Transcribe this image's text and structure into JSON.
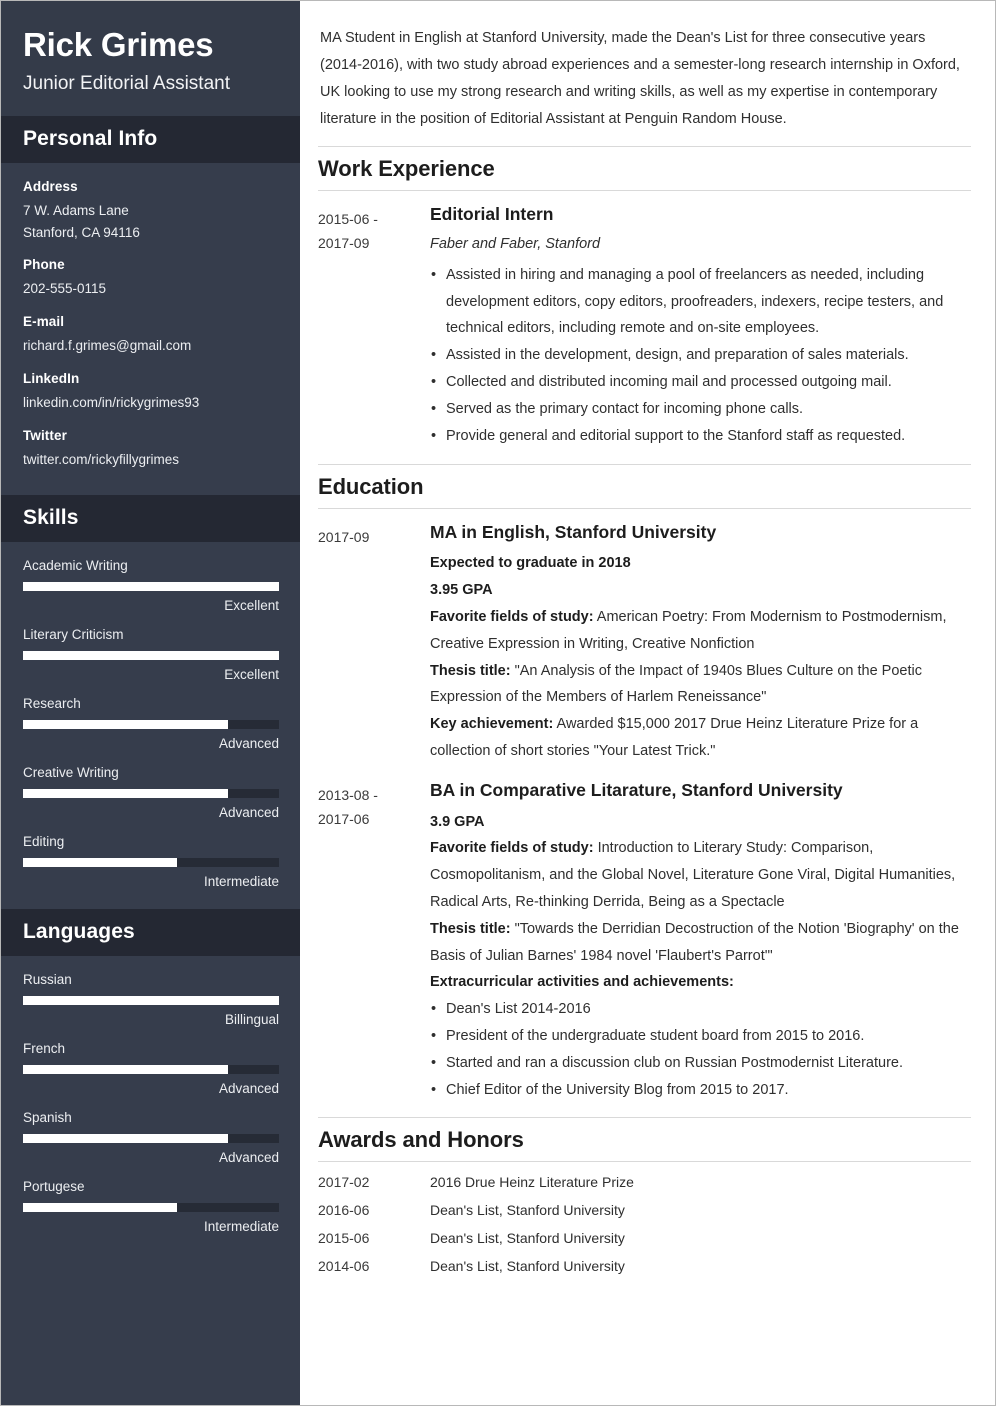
{
  "theme": {
    "sidebar_bg": "#363d4c",
    "sidebar_band_bg": "#242833",
    "sidebar_text": "#ffffff",
    "meter_fill": "#ffffff",
    "meter_track": "#262b36",
    "main_bg": "#ffffff",
    "main_text": "#2f2f2f",
    "rule": "#d9d9d9"
  },
  "sidebar": {
    "name": "Rick Grimes",
    "job_title": "Junior Editorial Assistant",
    "personal_info": {
      "heading": "Personal Info",
      "groups": [
        {
          "label": "Address",
          "lines": [
            "7 W. Adams Lane",
            "Stanford, CA 94116"
          ]
        },
        {
          "label": "Phone",
          "lines": [
            "202-555-0115"
          ]
        },
        {
          "label": "E-mail",
          "lines": [
            "richard.f.grimes@gmail.com"
          ]
        },
        {
          "label": "LinkedIn",
          "lines": [
            "linkedin.com/in/rickygrimes93"
          ]
        },
        {
          "label": "Twitter",
          "lines": [
            "twitter.com/rickyfillygrimes"
          ]
        }
      ]
    },
    "skills": {
      "heading": "Skills",
      "items": [
        {
          "name": "Academic Writing",
          "level": "Excellent",
          "percent": 100
        },
        {
          "name": "Literary Criticism",
          "level": "Excellent",
          "percent": 100
        },
        {
          "name": "Research",
          "level": "Advanced",
          "percent": 80
        },
        {
          "name": "Creative Writing",
          "level": "Advanced",
          "percent": 80
        },
        {
          "name": "Editing",
          "level": "Intermediate",
          "percent": 60
        }
      ]
    },
    "languages": {
      "heading": "Languages",
      "items": [
        {
          "name": "Russian",
          "level": "Billingual",
          "percent": 100
        },
        {
          "name": "French",
          "level": "Advanced",
          "percent": 80
        },
        {
          "name": "Spanish",
          "level": "Advanced",
          "percent": 80
        },
        {
          "name": "Portugese",
          "level": "Intermediate",
          "percent": 60
        }
      ]
    }
  },
  "main": {
    "summary": "MA Student in English at Stanford University, made the Dean's List for three consecutive years (2014-2016), with two study abroad experiences and a semester-long research internship in Oxford, UK looking to use my strong research and writing skills, as well as my expertise in contemporary literature in the position of Editorial Assistant at Penguin Random House.",
    "work_experience": {
      "heading": "Work Experience",
      "entries": [
        {
          "date_start": "2015-06 -",
          "date_end": "2017-09",
          "title": "Editorial Intern",
          "employer": "Faber and Faber, Stanford",
          "bullets": [
            "Assisted in hiring and managing a pool of freelancers as needed, including development editors, copy editors, proofreaders, indexers, recipe testers, and technical editors, including remote and on-site employees.",
            "Assisted in the development, design, and preparation of sales materials.",
            "Collected and distributed incoming mail and processed outgoing mail.",
            "Served as the primary contact for incoming phone calls.",
            "Provide general and editorial support to the Stanford staff as requested."
          ]
        }
      ]
    },
    "education": {
      "heading": "Education",
      "entries": [
        {
          "date_start": "2017-09",
          "date_end": "",
          "title": "MA in English, Stanford University",
          "strong_lines": [
            "Expected to graduate in 2018",
            "3.95 GPA"
          ],
          "details": [
            {
              "label": "Favorite fields of study:",
              "text": " American Poetry: From Modernism to Postmodernism, Creative Expression in Writing, Creative Nonfiction"
            },
            {
              "label": "Thesis title:",
              "text": " \"An Analysis of the Impact of 1940s Blues Culture on the Poetic Expression of the Members of Harlem Reneissance\""
            },
            {
              "label": "Key achievement:",
              "text": " Awarded $15,000 2017 Drue Heinz Literature Prize for a collection of short stories \"Your Latest Trick.\""
            }
          ],
          "bullets_heading": "",
          "bullets": []
        },
        {
          "date_start": "2013-08 -",
          "date_end": "2017-06",
          "title": "BA in Comparative Litarature, Stanford University",
          "strong_lines": [
            "3.9 GPA"
          ],
          "details": [
            {
              "label": "Favorite fields of study:",
              "text": " Introduction to Literary Study: Comparison, Cosmopolitanism, and the Global Novel, Literature Gone Viral, Digital Humanities, Radical Arts, Re-thinking Derrida, Being as a Spectacle"
            },
            {
              "label": "Thesis title:",
              "text": " \"Towards the Derridian Decostruction of the Notion 'Biography' on the Basis of Julian Barnes' 1984 novel 'Flaubert's Parrot'\""
            }
          ],
          "bullets_heading": "Extracurricular activities and achievements:",
          "bullets": [
            "Dean's List 2014-2016",
            "President of the undergraduate student board from 2015 to 2016.",
            "Started and ran a discussion club on Russian Postmodernist Literature.",
            "Chief Editor of the University Blog from 2015 to 2017."
          ]
        }
      ]
    },
    "awards": {
      "heading": "Awards and Honors",
      "rows": [
        {
          "date": "2017-02",
          "text": "2016 Drue Heinz Literature Prize"
        },
        {
          "date": "2016-06",
          "text": "Dean's List, Stanford University"
        },
        {
          "date": "2015-06",
          "text": "Dean's List, Stanford University"
        },
        {
          "date": "2014-06",
          "text": "Dean's List, Stanford University"
        }
      ]
    }
  }
}
